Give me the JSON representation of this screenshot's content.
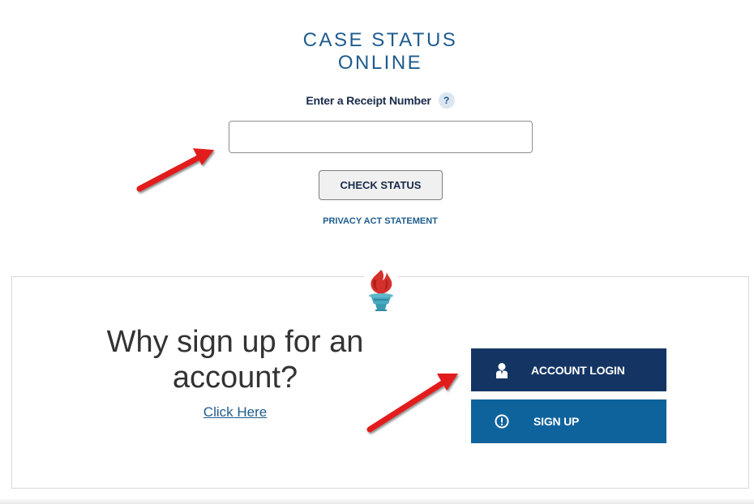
{
  "case_status": {
    "title_line1": "CASE STATUS",
    "title_line2": "ONLINE",
    "receipt_label": "Enter a Receipt Number",
    "help_icon_glyph": "?",
    "receipt_value": "",
    "check_status_label": "CHECK STATUS",
    "privacy_link": "PRIVACY ACT STATEMENT"
  },
  "account_panel": {
    "emblem_icon": "torch-icon",
    "heading": "Why sign up for an account?",
    "click_here": "Click Here",
    "login_button": {
      "label": "ACCOUNT LOGIN",
      "icon": "user-icon"
    },
    "signup_button": {
      "label": "SIGN UP",
      "icon": "exclamation-circle-icon"
    }
  },
  "annotations": {
    "arrow_color": "#e21b1b",
    "arrow_targets": [
      "receipt-number-input",
      "account-login-button"
    ]
  },
  "colors": {
    "title": "#1f5c8e",
    "login_bg": "#143563",
    "signup_bg": "#0e639c"
  }
}
